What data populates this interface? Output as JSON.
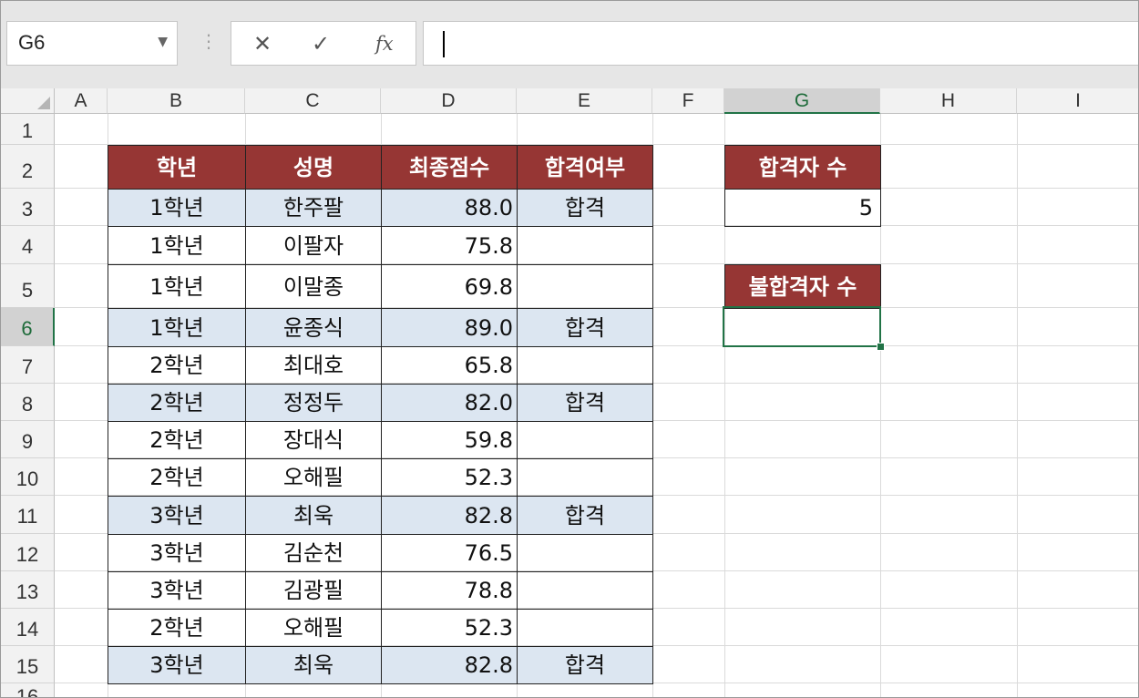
{
  "name_box": "G6",
  "name_box_dropdown": "▼",
  "formula": {
    "cancel": "✕",
    "enter": "✓",
    "fx": "fx",
    "value": ""
  },
  "columns": [
    "A",
    "B",
    "C",
    "D",
    "E",
    "F",
    "G",
    "H",
    "I"
  ],
  "rows": [
    "1",
    "2",
    "3",
    "4",
    "5",
    "6",
    "7",
    "8",
    "9",
    "10",
    "11",
    "12",
    "13",
    "14",
    "15",
    "16"
  ],
  "selected_cell": "G6",
  "table": {
    "headers": [
      "학년",
      "성명",
      "최종점수",
      "합격여부"
    ],
    "rows": [
      {
        "grade": "1학년",
        "name": "한주팔",
        "score": "88.0",
        "result": "합격"
      },
      {
        "grade": "1학년",
        "name": "이팔자",
        "score": "75.8",
        "result": ""
      },
      {
        "grade": "1학년",
        "name": "이말종",
        "score": "69.8",
        "result": ""
      },
      {
        "grade": "1학년",
        "name": "윤종식",
        "score": "89.0",
        "result": "합격"
      },
      {
        "grade": "2학년",
        "name": "최대호",
        "score": "65.8",
        "result": ""
      },
      {
        "grade": "2학년",
        "name": "정정두",
        "score": "82.0",
        "result": "합격"
      },
      {
        "grade": "2학년",
        "name": "장대식",
        "score": "59.8",
        "result": ""
      },
      {
        "grade": "2학년",
        "name": "오해필",
        "score": "52.3",
        "result": ""
      },
      {
        "grade": "3학년",
        "name": "최욱",
        "score": "82.8",
        "result": "합격"
      },
      {
        "grade": "3학년",
        "name": "김순천",
        "score": "76.5",
        "result": ""
      },
      {
        "grade": "3학년",
        "name": "김광필",
        "score": "78.8",
        "result": ""
      },
      {
        "grade": "2학년",
        "name": "오해필",
        "score": "52.3",
        "result": ""
      },
      {
        "grade": "3학년",
        "name": "최욱",
        "score": "82.8",
        "result": "합격"
      }
    ]
  },
  "pass_count": {
    "label": "합격자 수",
    "value": "5"
  },
  "fail_count": {
    "label": "불합격자 수",
    "value": ""
  },
  "colors": {
    "header_fill": "#963634",
    "highlight_fill": "#dce6f1",
    "selection": "#217346"
  }
}
